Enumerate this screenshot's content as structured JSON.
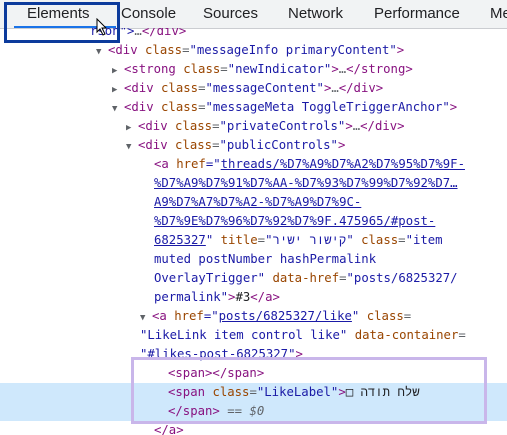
{
  "tabs": [
    {
      "label": "Elements"
    },
    {
      "label": "Console"
    },
    {
      "label": "Sources"
    },
    {
      "label": "Network"
    },
    {
      "label": "Performance"
    },
    {
      "label": "Me"
    }
  ],
  "tree": {
    "r0": {
      "a": "rson\">",
      "b": "…",
      "c": "</div>"
    },
    "r1": {
      "tag": "<div",
      "attr": "class",
      "val": "\"messageInfo primaryContent\"",
      "close": ">"
    },
    "r2": {
      "tag": "<strong",
      "attr": "class",
      "val": "\"newIndicator\"",
      "close": ">",
      "ell": "…",
      "end": "</strong>"
    },
    "r3": {
      "tag": "<div",
      "attr": "class",
      "val": "\"messageContent\"",
      "close": ">",
      "ell": "…",
      "end": "</div>"
    },
    "r4": {
      "tag": "<div",
      "attr": "class",
      "val": "\"messageMeta ToggleTriggerAnchor\"",
      "close": ">"
    },
    "r5": {
      "tag": "<div",
      "attr": "class",
      "val": "\"privateControls\"",
      "close": ">",
      "ell": "…",
      "end": "</div>"
    },
    "r6": {
      "tag": "<div",
      "attr": "class",
      "val": "\"publicControls\"",
      "close": ">"
    },
    "r7": {
      "tag": "<a",
      "attr": "href",
      "eq": "=\"",
      "link": "threads/%D7%A9%D7%A2%D7%95%D7%9F-"
    },
    "r8": {
      "link": "%D7%A9%D7%91%D7%AA-%D7%93%D7%99%D7%92%D7…"
    },
    "r9": {
      "link": "A9%D7%A7%D7%A2-%D7%A9%D7%9C-"
    },
    "r10": {
      "link": "%D7%9E%D7%96%D7%92%D7%9F.475965/#post-"
    },
    "r11": {
      "link": "6825327",
      "q": "\"",
      "attr": "title",
      "val": "\"קישור ישיר\"",
      "attr2": "class",
      "val2": "\"item"
    },
    "r12": {
      "val": "muted postNumber hashPermalink"
    },
    "r13": {
      "val": "OverlayTrigger\"",
      "attr": "data-href",
      "val2": "\"posts/6825327/"
    },
    "r14": {
      "val": "permalink\"",
      "close": ">",
      "txt": "#3",
      "end": "</a>"
    },
    "r15": {
      "tag": "<a",
      "attr": "href",
      "eq": "=\"",
      "link": "posts/6825327/like",
      "q": "\"",
      "attr2": "class"
    },
    "r16": {
      "val": "\"LikeLink item control like\"",
      "attr": "data-container"
    },
    "r17": {
      "val": "\"#likes-post-6825327\"",
      "close": ">"
    },
    "r18": {
      "tag": "<span></span>"
    },
    "r19": {
      "tag": "<span",
      "attr": "class",
      "val": "\"LikeLabel\"",
      "close": ">",
      "txt": "שלח תודה",
      "box": "□"
    },
    "r20": {
      "tag": "</span>",
      "eq": "==",
      "dollar": "$0"
    },
    "r21": {
      "tag": "</a>"
    }
  },
  "colors": {
    "tag": "#881280",
    "attribute": "#994500",
    "value": "#1a1aa6",
    "selected_row": "#cfe8fc",
    "tab_underline": "#1a73e8",
    "annotation_blue": "#0c3b9c",
    "annotation_purple": "#c9b6ea"
  }
}
